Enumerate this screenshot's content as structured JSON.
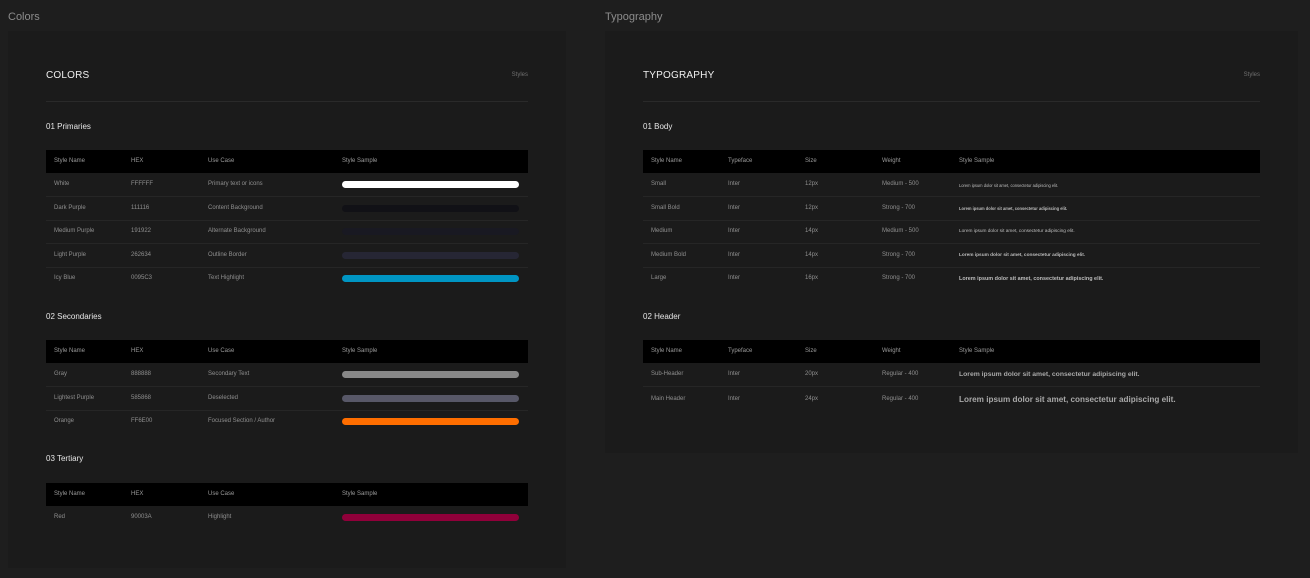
{
  "frames": {
    "colors_label": "Colors",
    "typography_label": "Typography"
  },
  "colors": {
    "title": "COLORS",
    "tag": "Styles",
    "headers": [
      "Style Name",
      "HEX",
      "Use Case",
      "Style Sample"
    ],
    "sections": [
      {
        "title": "01 Primaries",
        "rows": [
          {
            "name": "White",
            "hex": "FFFFFF",
            "use": "Primary text or icons",
            "color": "#FFFFFF"
          },
          {
            "name": "Dark Purple",
            "hex": "111116",
            "use": "Content Background",
            "color": "#111116"
          },
          {
            "name": "Medium Purple",
            "hex": "191922",
            "use": "Alternate Background",
            "color": "#191922"
          },
          {
            "name": "Light Purple",
            "hex": "262634",
            "use": "Outline Border",
            "color": "#262634"
          },
          {
            "name": "Icy Blue",
            "hex": "0095C3",
            "use": "Text Highlight",
            "color": "#0095C3"
          }
        ]
      },
      {
        "title": "02 Secondaries",
        "rows": [
          {
            "name": "Gray",
            "hex": "888888",
            "use": "Secondary Text",
            "color": "#888888"
          },
          {
            "name": "Lightest Purple",
            "hex": "585868",
            "use": "Deselected",
            "color": "#585868"
          },
          {
            "name": "Orange",
            "hex": "FF6E00",
            "use": "Focused Section / Author",
            "color": "#FF6E00"
          }
        ]
      },
      {
        "title": "03 Tertiary",
        "rows": [
          {
            "name": "Red",
            "hex": "90003A",
            "use": "Highlight",
            "color": "#90003A"
          }
        ]
      }
    ]
  },
  "typography": {
    "title": "TYPOGRAPHY",
    "tag": "Styles",
    "headers": [
      "Style Name",
      "Typeface",
      "Size",
      "Weight",
      "Style Sample"
    ],
    "sample_text": "Lorem ipsum dolor sit amet, consectetur adipiscing elit.",
    "sections": [
      {
        "title": "01 Body",
        "rows": [
          {
            "name": "Small",
            "typeface": "Inter",
            "size": "12px",
            "weight": "Medium - 500"
          },
          {
            "name": "Small Bold",
            "typeface": "Inter",
            "size": "12px",
            "weight": "Strong - 700"
          },
          {
            "name": "Medium",
            "typeface": "Inter",
            "size": "14px",
            "weight": "Medium - 500"
          },
          {
            "name": "Medium Bold",
            "typeface": "Inter",
            "size": "14px",
            "weight": "Strong - 700"
          },
          {
            "name": "Large",
            "typeface": "Inter",
            "size": "16px",
            "weight": "Strong - 700"
          }
        ]
      },
      {
        "title": "02 Header",
        "rows": [
          {
            "name": "Sub-Header",
            "typeface": "Inter",
            "size": "20px",
            "weight": "Regular - 400"
          },
          {
            "name": "Main Header",
            "typeface": "Inter",
            "size": "24px",
            "weight": "Regular - 400"
          }
        ]
      }
    ]
  }
}
